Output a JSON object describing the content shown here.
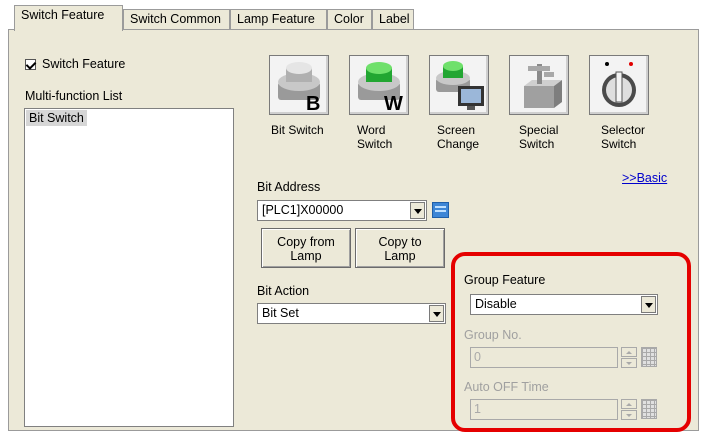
{
  "tabs": [
    {
      "label": "Switch Feature",
      "active": true
    },
    {
      "label": "Switch Common",
      "active": false
    },
    {
      "label": "Lamp Feature",
      "active": false
    },
    {
      "label": "Color",
      "active": false
    },
    {
      "label": "Label",
      "active": false
    }
  ],
  "switch_feature": {
    "label": "Switch Feature",
    "checked": true
  },
  "multi_function": {
    "label": "Multi-function List",
    "items": [
      "Bit Switch"
    ]
  },
  "switch_types": [
    {
      "label": "Bit Switch",
      "icon": "bit-switch-icon"
    },
    {
      "label": "Word\nSwitch",
      "icon": "word-switch-icon"
    },
    {
      "label": "Screen\nChange",
      "icon": "screen-change-icon"
    },
    {
      "label": "Special\nSwitch",
      "icon": "special-switch-icon"
    },
    {
      "label": "Selector\nSwitch",
      "icon": "selector-switch-icon"
    }
  ],
  "basic_link": ">>Basic",
  "bit_address": {
    "label": "Bit Address",
    "value": "[PLC1]X00000"
  },
  "copy_from_lamp": "Copy from\nLamp",
  "copy_to_lamp": "Copy to\nLamp",
  "bit_action": {
    "label": "Bit Action",
    "value": "Bit Set"
  },
  "group_feature": {
    "label": "Group Feature",
    "value": "Disable"
  },
  "group_no": {
    "label": "Group No.",
    "value": "0"
  },
  "auto_off_time": {
    "label": "Auto OFF Time",
    "value": "1"
  },
  "colors": {
    "highlight": "#e50000",
    "panel": "#ece9d8",
    "link": "#0000cc"
  }
}
